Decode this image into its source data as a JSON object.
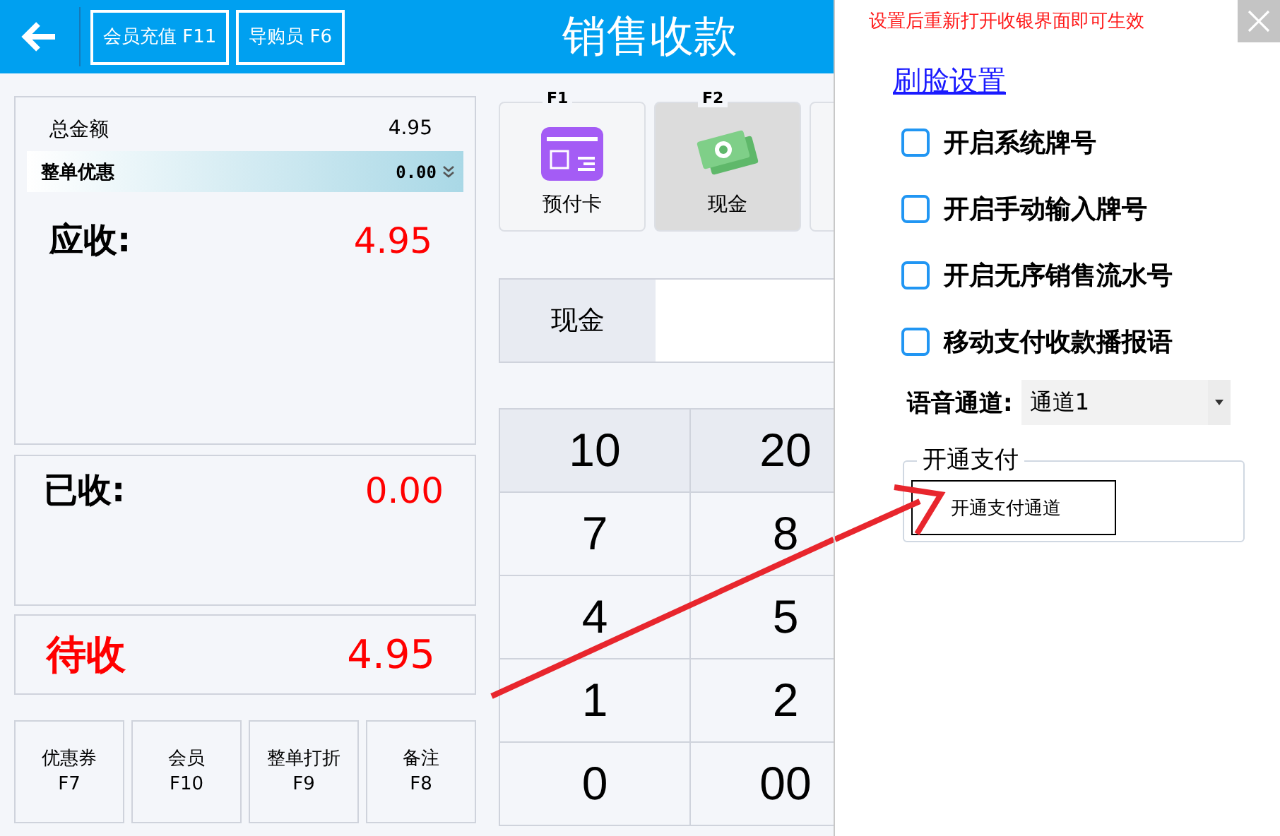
{
  "header": {
    "buttons": [
      "会员充值 F11",
      "导购员 F6"
    ],
    "title": "销售收款"
  },
  "summary": {
    "total_label": "总金额",
    "total_value": "4.95",
    "discount_label": "整单优惠",
    "discount_value": "0.00",
    "receivable_label": "应收:",
    "receivable_value": "4.95",
    "received_label": "已收:",
    "received_value": "0.00",
    "pending_label": "待收",
    "pending_value": "4.95"
  },
  "function_buttons": [
    {
      "label": "优惠券",
      "key": "F7"
    },
    {
      "label": "会员",
      "key": "F10"
    },
    {
      "label": "整单打折",
      "key": "F9"
    },
    {
      "label": "备注",
      "key": "F8"
    }
  ],
  "payment_methods": [
    {
      "key": "F1",
      "label": "预付卡",
      "kind": "prepaid",
      "selected": false
    },
    {
      "key": "F2",
      "label": "现金",
      "kind": "cash",
      "selected": true
    },
    {
      "kind": "blank",
      "selected": false
    }
  ],
  "amount_row": {
    "label": "现金"
  },
  "keypad": [
    [
      "10",
      "20"
    ],
    [
      "7",
      "8"
    ],
    [
      "4",
      "5"
    ],
    [
      "1",
      "2"
    ],
    [
      "0",
      "00"
    ]
  ],
  "settings": {
    "notice": "设置后重新打开收银界面即可生效",
    "link": "刷脸设置",
    "checkboxes": [
      {
        "label": "开启系统牌号",
        "checked": false
      },
      {
        "label": "开启手动输入牌号",
        "checked": false
      },
      {
        "label": "开启无序销售流水号",
        "checked": false
      },
      {
        "label": "移动支付收款播报语",
        "checked": false
      }
    ],
    "voice_channel": {
      "label": "语音通道:",
      "value": "通道1"
    },
    "payment_group": {
      "legend": "开通支付",
      "button": "开通支付通道"
    }
  }
}
